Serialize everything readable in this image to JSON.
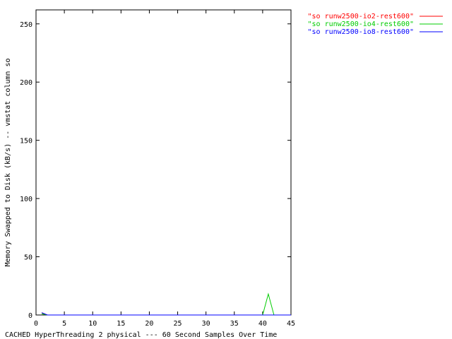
{
  "chart_data": {
    "type": "line",
    "title": "",
    "xlabel": "CACHED HyperThreading 2 physical --- 60 Second Samples Over Time",
    "ylabel": "Memory Swapped to Disk (kB/s) -- vmstat column so",
    "xlim": [
      0,
      45
    ],
    "ylim": [
      0,
      262
    ],
    "x_ticks": [
      0,
      5,
      10,
      15,
      20,
      25,
      30,
      35,
      40,
      45
    ],
    "y_ticks": [
      0,
      50,
      100,
      150,
      200,
      250
    ],
    "grid": false,
    "legend_position": "outside-top-right",
    "series": [
      {
        "name": "\"so runw2500-io2-rest600\"",
        "color": "#ff0000",
        "x": [
          1,
          2,
          3,
          4,
          5,
          6,
          7,
          8,
          9,
          10,
          11,
          12,
          13,
          14,
          15,
          16,
          17,
          18,
          19,
          20,
          21,
          22,
          23,
          24,
          25,
          26,
          27,
          28,
          29,
          30,
          31,
          32,
          33,
          34,
          35,
          36,
          37,
          38,
          39,
          40,
          41,
          42
        ],
        "y": [
          2,
          0,
          0,
          0,
          0,
          0,
          0,
          0,
          0,
          0,
          0,
          0,
          0,
          0,
          0,
          0,
          0,
          0,
          0,
          0,
          0,
          0,
          0,
          0,
          0,
          0,
          0,
          0,
          0,
          0,
          0,
          0,
          0,
          0,
          0,
          0,
          0,
          0,
          0,
          0,
          0,
          0
        ]
      },
      {
        "name": "\"so runw2500-io4-rest600\"",
        "color": "#00cc00",
        "x": [
          1,
          2,
          3,
          4,
          5,
          6,
          7,
          8,
          9,
          10,
          11,
          12,
          13,
          14,
          15,
          16,
          17,
          18,
          19,
          20,
          21,
          22,
          23,
          24,
          25,
          26,
          27,
          28,
          29,
          30,
          31,
          32,
          33,
          34,
          35,
          36,
          37,
          38,
          39,
          40,
          41,
          42,
          43,
          44,
          45
        ],
        "y": [
          1,
          0,
          0,
          0,
          0,
          0,
          0,
          0,
          0,
          0,
          0,
          0,
          0,
          0,
          0,
          0,
          0,
          0,
          0,
          0,
          0,
          0,
          0,
          0,
          0,
          0,
          0,
          0,
          0,
          0,
          0,
          0,
          0,
          0,
          0,
          0,
          0,
          0,
          0,
          0,
          18,
          0,
          0,
          0,
          0
        ]
      },
      {
        "name": "\"so runw2500-io8-rest600\"",
        "color": "#0000ff",
        "x": [
          1,
          2,
          3,
          4,
          5,
          6,
          7,
          8,
          9,
          10,
          11,
          12,
          13,
          14,
          15,
          16,
          17,
          18,
          19,
          20,
          21,
          22,
          23,
          24,
          25,
          26,
          27,
          28,
          29,
          30,
          31,
          32,
          33,
          34,
          35,
          36,
          37,
          38,
          39,
          40,
          41,
          42,
          43,
          44,
          45
        ],
        "y": [
          2,
          0,
          0,
          0,
          0,
          0,
          0,
          0,
          0,
          0,
          0,
          0,
          0,
          0,
          0,
          0,
          0,
          0,
          0,
          0,
          0,
          0,
          0,
          0,
          0,
          0,
          0,
          0,
          0,
          0,
          0,
          0,
          0,
          0,
          0,
          0,
          0,
          0,
          0,
          0,
          0,
          0,
          0,
          0,
          0
        ]
      }
    ]
  }
}
